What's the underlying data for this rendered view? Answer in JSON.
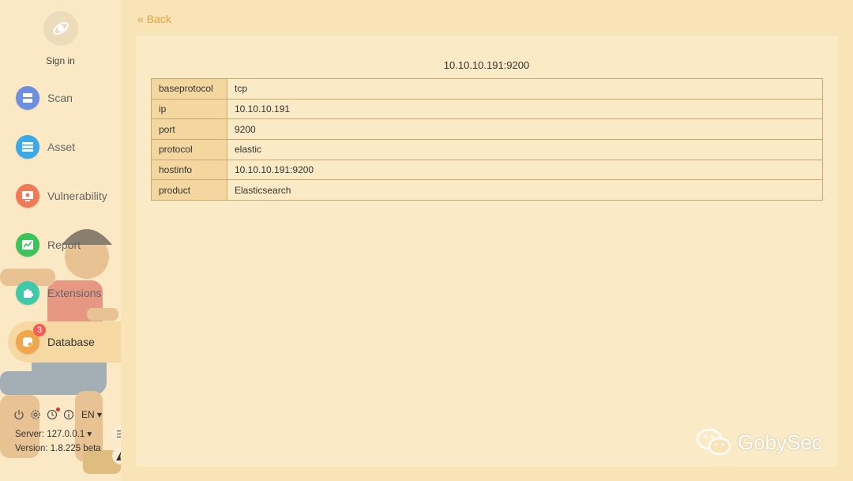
{
  "sidebar": {
    "signin": "Sign in",
    "items": [
      {
        "label": "Scan",
        "icon": "scan-icon",
        "color": "#6c8fe0"
      },
      {
        "label": "Asset",
        "icon": "asset-icon",
        "color": "#3aa9e6"
      },
      {
        "label": "Vulnerability",
        "icon": "vulnerability-icon",
        "color": "#f07a55"
      },
      {
        "label": "Report",
        "icon": "report-icon",
        "color": "#3cc35a"
      },
      {
        "label": "Extensions",
        "icon": "extensions-icon",
        "color": "#3fc9a8"
      },
      {
        "label": "Database",
        "icon": "database-icon",
        "color": "#f0a64a",
        "badge": "3",
        "active": true
      }
    ],
    "lang": "EN",
    "server_label": "Server: 127.0.0.1",
    "version_label": "Version: 1.8.225 beta"
  },
  "main": {
    "back_label": "Back",
    "title": "10.10.10.191:9200",
    "rows": [
      {
        "key": "baseprotocol",
        "value": "tcp"
      },
      {
        "key": "ip",
        "value": "10.10.10.191"
      },
      {
        "key": "port",
        "value": "9200"
      },
      {
        "key": "protocol",
        "value": "elastic"
      },
      {
        "key": "hostinfo",
        "value": "10.10.10.191:9200"
      },
      {
        "key": "product",
        "value": "Elasticsearch"
      }
    ]
  },
  "watermark": "GobySec",
  "colors": {
    "accent": "#e2a23c",
    "background": "#f9e4b7",
    "panel": "#fbeac6",
    "key_cell": "#f3d79f"
  }
}
